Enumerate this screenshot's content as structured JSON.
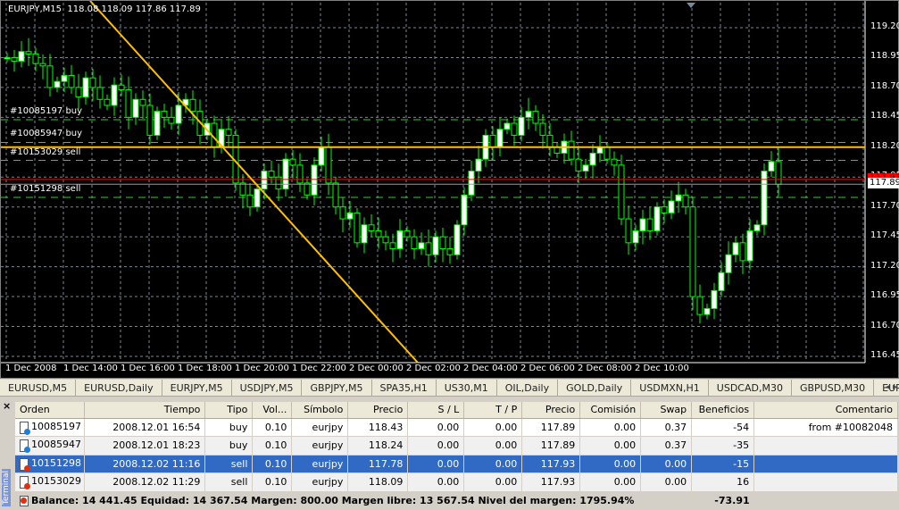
{
  "chart": {
    "symbol": "EURJPY,M15",
    "ohlc": "118.08 118.09 117.86 117.89",
    "bid": "117.89",
    "ask": "117.93",
    "price_ticks": [
      "119.20",
      "118.95",
      "118.70",
      "118.45",
      "118.20",
      "117.95",
      "117.70",
      "117.45",
      "117.20",
      "116.95",
      "116.70",
      "116.45"
    ],
    "time_ticks": [
      "1 Dec 2008",
      "1 Dec 14:00",
      "1 Dec 16:00",
      "1 Dec 18:00",
      "1 Dec 20:00",
      "1 Dec 22:00",
      "2 Dec 00:00",
      "2 Dec 02:00",
      "2 Dec 04:00",
      "2 Dec 06:00",
      "2 Dec 08:00",
      "2 Dec 10:00"
    ],
    "order_lines": [
      {
        "label": "#10085197 buy",
        "price": 118.43
      },
      {
        "label": "#10085947 buy",
        "price": 118.24
      },
      {
        "label": "#10153029 sell",
        "price": 118.09
      },
      {
        "label": "#10151298 sell",
        "price": 117.78
      }
    ],
    "horizontal_line": 118.2,
    "colors": {
      "bull": "#ffffff",
      "bear": "#000000",
      "outline": "#00ff00",
      "trend": "#ffc000",
      "ask": "#ff0000",
      "grid": "#778899"
    },
    "closes": [
      118.95,
      118.92,
      119.0,
      118.98,
      118.9,
      118.88,
      118.7,
      118.75,
      118.8,
      118.7,
      118.62,
      118.78,
      118.7,
      118.6,
      118.55,
      118.72,
      118.68,
      118.45,
      118.6,
      118.55,
      118.3,
      118.5,
      118.45,
      118.4,
      118.55,
      118.6,
      118.5,
      118.3,
      118.4,
      118.2,
      118.35,
      118.3,
      117.9,
      117.8,
      117.7,
      117.85,
      118.0,
      117.95,
      117.85,
      118.1,
      118.05,
      117.9,
      117.8,
      118.05,
      118.2,
      117.9,
      117.7,
      117.6,
      117.65,
      117.4,
      117.55,
      117.5,
      117.45,
      117.4,
      117.35,
      117.5,
      117.45,
      117.35,
      117.4,
      117.3,
      117.45,
      117.35,
      117.3,
      117.55,
      117.8,
      118.0,
      118.1,
      118.3,
      118.2,
      118.35,
      118.4,
      118.3,
      118.45,
      118.5,
      118.4,
      118.3,
      118.2,
      118.15,
      118.25,
      118.1,
      118.0,
      118.05,
      118.15,
      118.2,
      118.1,
      118.05,
      117.6,
      117.4,
      117.5,
      117.6,
      117.5,
      117.7,
      117.65,
      117.75,
      117.8,
      117.7,
      116.95,
      116.8,
      116.85,
      117.0,
      117.15,
      117.3,
      117.4,
      117.25,
      117.5,
      117.55,
      118.0,
      118.08,
      117.89
    ]
  },
  "tabs": [
    "EURUSD,M5",
    "EURUSD,Daily",
    "EURJPY,M5",
    "USDJPY,M5",
    "GBPJPY,M5",
    "SPA35,H1",
    "US30,M1",
    "OIL,Daily",
    "GOLD,Daily",
    "USDMXN,H1",
    "USDCAD,M30",
    "GBPUSD,M30",
    "EURGE"
  ],
  "terminal": {
    "side_label": "Terminal",
    "columns": [
      "Orden",
      "Tiempo",
      "Tipo",
      "Vol...",
      "Símbolo",
      "Precio",
      "S / L",
      "T / P",
      "Precio",
      "Comisión",
      "Swap",
      "Beneficios",
      "Comentario"
    ],
    "rows": [
      [
        "10085197",
        "2008.12.01 16:54",
        "buy",
        "0.10",
        "eurjpy",
        "118.43",
        "0.00",
        "0.00",
        "117.89",
        "0.00",
        "0.37",
        "-54",
        "from #10082048"
      ],
      [
        "10085947",
        "2008.12.01 18:23",
        "buy",
        "0.10",
        "eurjpy",
        "118.24",
        "0.00",
        "0.00",
        "117.89",
        "0.00",
        "0.37",
        "-35",
        ""
      ],
      [
        "10151298",
        "2008.12.02 11:16",
        "sell",
        "0.10",
        "eurjpy",
        "117.78",
        "0.00",
        "0.00",
        "117.93",
        "0.00",
        "0.00",
        "-15",
        ""
      ],
      [
        "10153029",
        "2008.12.02 11:29",
        "sell",
        "0.10",
        "eurjpy",
        "118.09",
        "0.00",
        "0.00",
        "117.93",
        "0.00",
        "0.00",
        "16",
        ""
      ]
    ],
    "selected_row": 2,
    "summary": "Balance: 14 441.45  Equidad: 14 367.54  Margen: 800.00  Margen libre: 13 567.54  Nivel del margen: 1795.94%",
    "total_profit": "-73.91"
  }
}
